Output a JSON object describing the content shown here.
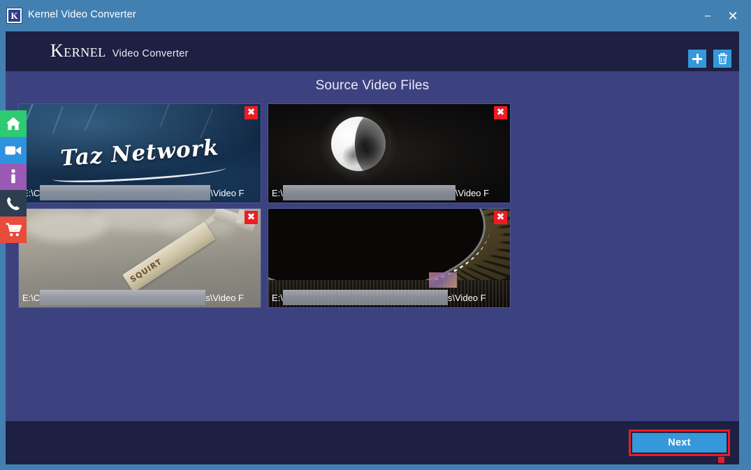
{
  "window": {
    "title": "Kernel Video Converter",
    "app_icon": "kernel-k-icon",
    "minimize_label": "–",
    "close_label": "✕"
  },
  "header": {
    "brand_main": "Kernel",
    "brand_sub": "Video Converter",
    "add_button_label": "+",
    "add_button_icon": "plus-icon",
    "delete_button_icon": "trash-icon"
  },
  "sidebar": {
    "items": [
      {
        "name": "home",
        "icon": "home-icon",
        "color": "#2ecc71"
      },
      {
        "name": "video",
        "icon": "video-camera-icon",
        "color": "#2e93df"
      },
      {
        "name": "info",
        "icon": "info-icon",
        "color": "#9b59b6"
      },
      {
        "name": "support",
        "icon": "phone-icon",
        "color": "#2c3e50"
      },
      {
        "name": "buy",
        "icon": "shopping-cart-icon",
        "color": "#e74c3c"
      }
    ]
  },
  "main": {
    "page_title": "Source Video Files",
    "thumbnails": [
      {
        "id": "taz-network",
        "thumb_text": "Taz Network",
        "path_prefix": "E:\\C",
        "path_suffix": "\\Video F",
        "close_label": "✖"
      },
      {
        "id": "moon",
        "thumb_text": "",
        "path_prefix": "E:\\",
        "path_suffix": "\\Video F",
        "close_label": "✖"
      },
      {
        "id": "plane-banner",
        "thumb_text": "SQUIRT",
        "path_prefix": "E:\\C",
        "path_suffix": "s\\Video F",
        "close_label": "✖"
      },
      {
        "id": "stadium",
        "thumb_text": "",
        "path_prefix": "E:\\",
        "path_suffix": "s\\Video F",
        "close_label": "✖"
      }
    ],
    "marker": "red-highlight-dot"
  },
  "footer": {
    "next_label": "Next"
  },
  "colors": {
    "titlebar": "#4380b2",
    "header_strip": "#1d2042",
    "content_bg": "#3c4280",
    "accent_blue": "#3498db",
    "highlight_red": "#ee1b24"
  }
}
